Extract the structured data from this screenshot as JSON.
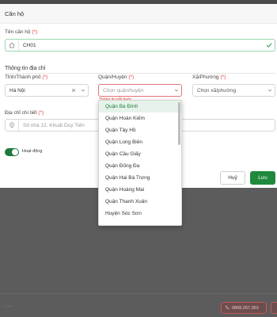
{
  "modal": {
    "title": "Căn hộ",
    "apartment_name": {
      "label": "Tên căn hộ",
      "required_mark": "(*)",
      "value": "CH01"
    },
    "address_section_title": "Thông tin địa chỉ",
    "province": {
      "label": "Tỉnh/Thành phố",
      "required_mark": "(*)",
      "value": "Hà Nội"
    },
    "district": {
      "label": "Quận/Huyện",
      "required_mark": "(*)",
      "placeholder": "Chọn quận/huyện",
      "error": "Thông tin bắt buộc"
    },
    "ward": {
      "label": "Xã/Phường",
      "required_mark": "(*)",
      "placeholder": "Chọn xã/phường"
    },
    "detail_address": {
      "label": "Địa chỉ chi tiết",
      "required_mark": "(*)",
      "placeholder": "Số nhà 12, Khuất Duy Tiến"
    },
    "active_toggle": {
      "label": "Hoạt động",
      "on": true
    },
    "buttons": {
      "cancel": "Huỷ",
      "save": "Lưu"
    }
  },
  "district_dropdown": {
    "options": [
      "Quận Ba Đình",
      "Quận Hoàn Kiếm",
      "Quận Tây Hồ",
      "Quận Long Biên",
      "Quận Cầu Giấy",
      "Quận Đống Đa",
      "Quận Hai Bà Trưng",
      "Quận Hoàng Mai",
      "Quận Thanh Xuân",
      "Huyện Sóc Sơn"
    ],
    "highlighted_index": 0
  },
  "background": {
    "phone": "0868.267.263"
  },
  "colors": {
    "primary": "#1f8a3c",
    "error": "#e53935",
    "highlight_bg": "#e6f3ea"
  }
}
